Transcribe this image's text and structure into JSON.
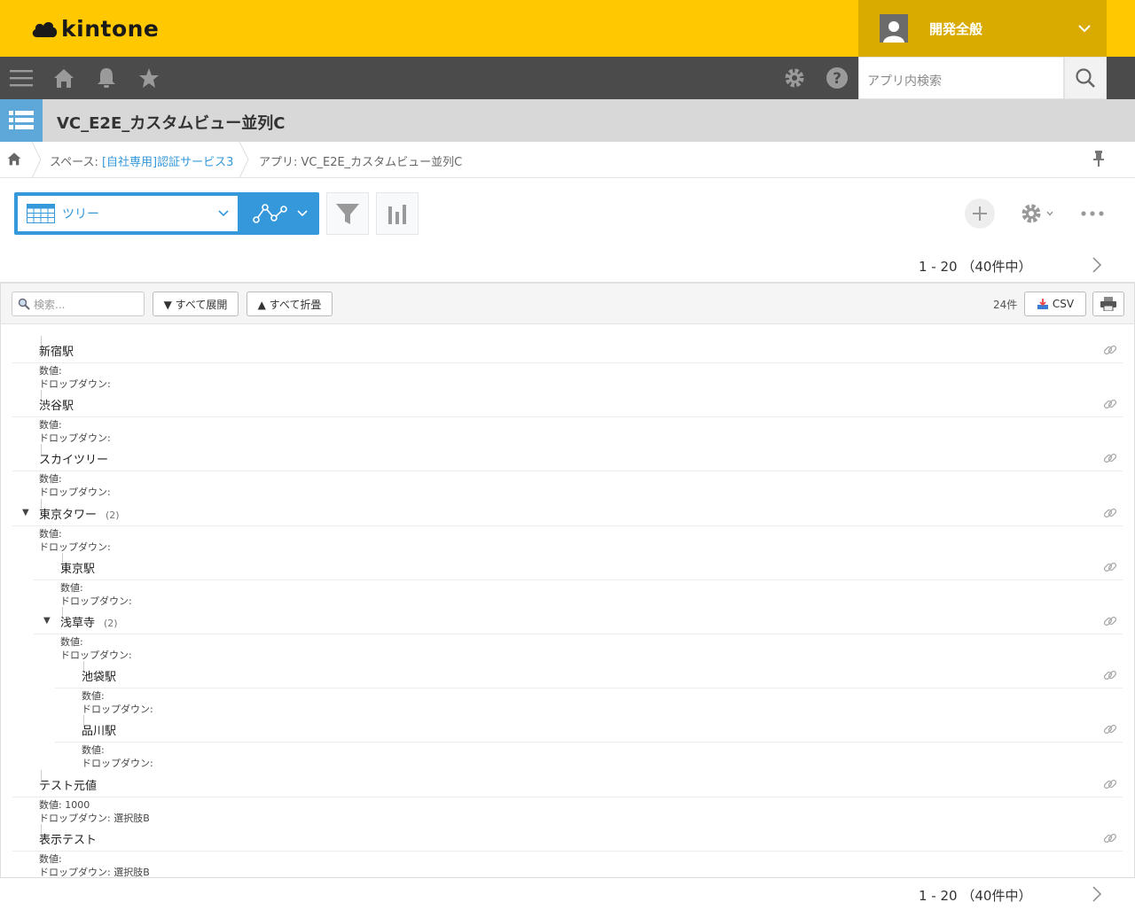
{
  "header": {
    "logo_text": "kintone",
    "user_name": "開発全般"
  },
  "nav": {
    "search_placeholder": "アプリ内検索"
  },
  "app": {
    "title": "VC_E2E_カスタムビュー並列C"
  },
  "breadcrumb": {
    "space_prefix": "スペース: ",
    "space_name": "[自社専用]認証サービス3",
    "app_label": "アプリ: VC_E2E_カスタムビュー並列C"
  },
  "view": {
    "selected": "ツリー"
  },
  "pager": {
    "range": "1 - 20",
    "total": "（40件中）"
  },
  "tree_toolbar": {
    "search_placeholder": "検索...",
    "expand_all": "▼ すべて展開",
    "collapse_all": "▲ すべて折畳",
    "count": "24件",
    "csv_label": "CSV"
  },
  "field_labels": {
    "number": "数値:",
    "dropdown": "ドロップダウン:"
  },
  "nodes": [
    {
      "name": "新宿駅",
      "count": "",
      "expanded": false,
      "depth": 0,
      "number": "",
      "dropdown": ""
    },
    {
      "name": "渋谷駅",
      "count": "",
      "expanded": false,
      "depth": 0,
      "number": "",
      "dropdown": ""
    },
    {
      "name": "スカイツリー",
      "count": "",
      "expanded": false,
      "depth": 0,
      "number": "",
      "dropdown": ""
    },
    {
      "name": "東京タワー",
      "count": "(2)",
      "expanded": true,
      "depth": 0,
      "number": "",
      "dropdown": ""
    },
    {
      "name": "東京駅",
      "count": "",
      "expanded": false,
      "depth": 1,
      "number": "",
      "dropdown": ""
    },
    {
      "name": "浅草寺",
      "count": "(2)",
      "expanded": true,
      "depth": 1,
      "number": "",
      "dropdown": ""
    },
    {
      "name": "池袋駅",
      "count": "",
      "expanded": false,
      "depth": 2,
      "number": "",
      "dropdown": ""
    },
    {
      "name": "品川駅",
      "count": "",
      "expanded": false,
      "depth": 2,
      "number": "",
      "dropdown": ""
    },
    {
      "name": "テスト元値",
      "count": "",
      "expanded": false,
      "depth": 0,
      "number": "1000",
      "dropdown": "選択肢B"
    },
    {
      "name": "表示テスト",
      "count": "",
      "expanded": false,
      "depth": 0,
      "number": "",
      "dropdown": "選択肢B"
    }
  ],
  "colors": {
    "header_bg": "#ffc800",
    "nav_bg": "#4b4b4b",
    "accent": "#3498db",
    "user_menu_bg": "#d9ab00"
  }
}
